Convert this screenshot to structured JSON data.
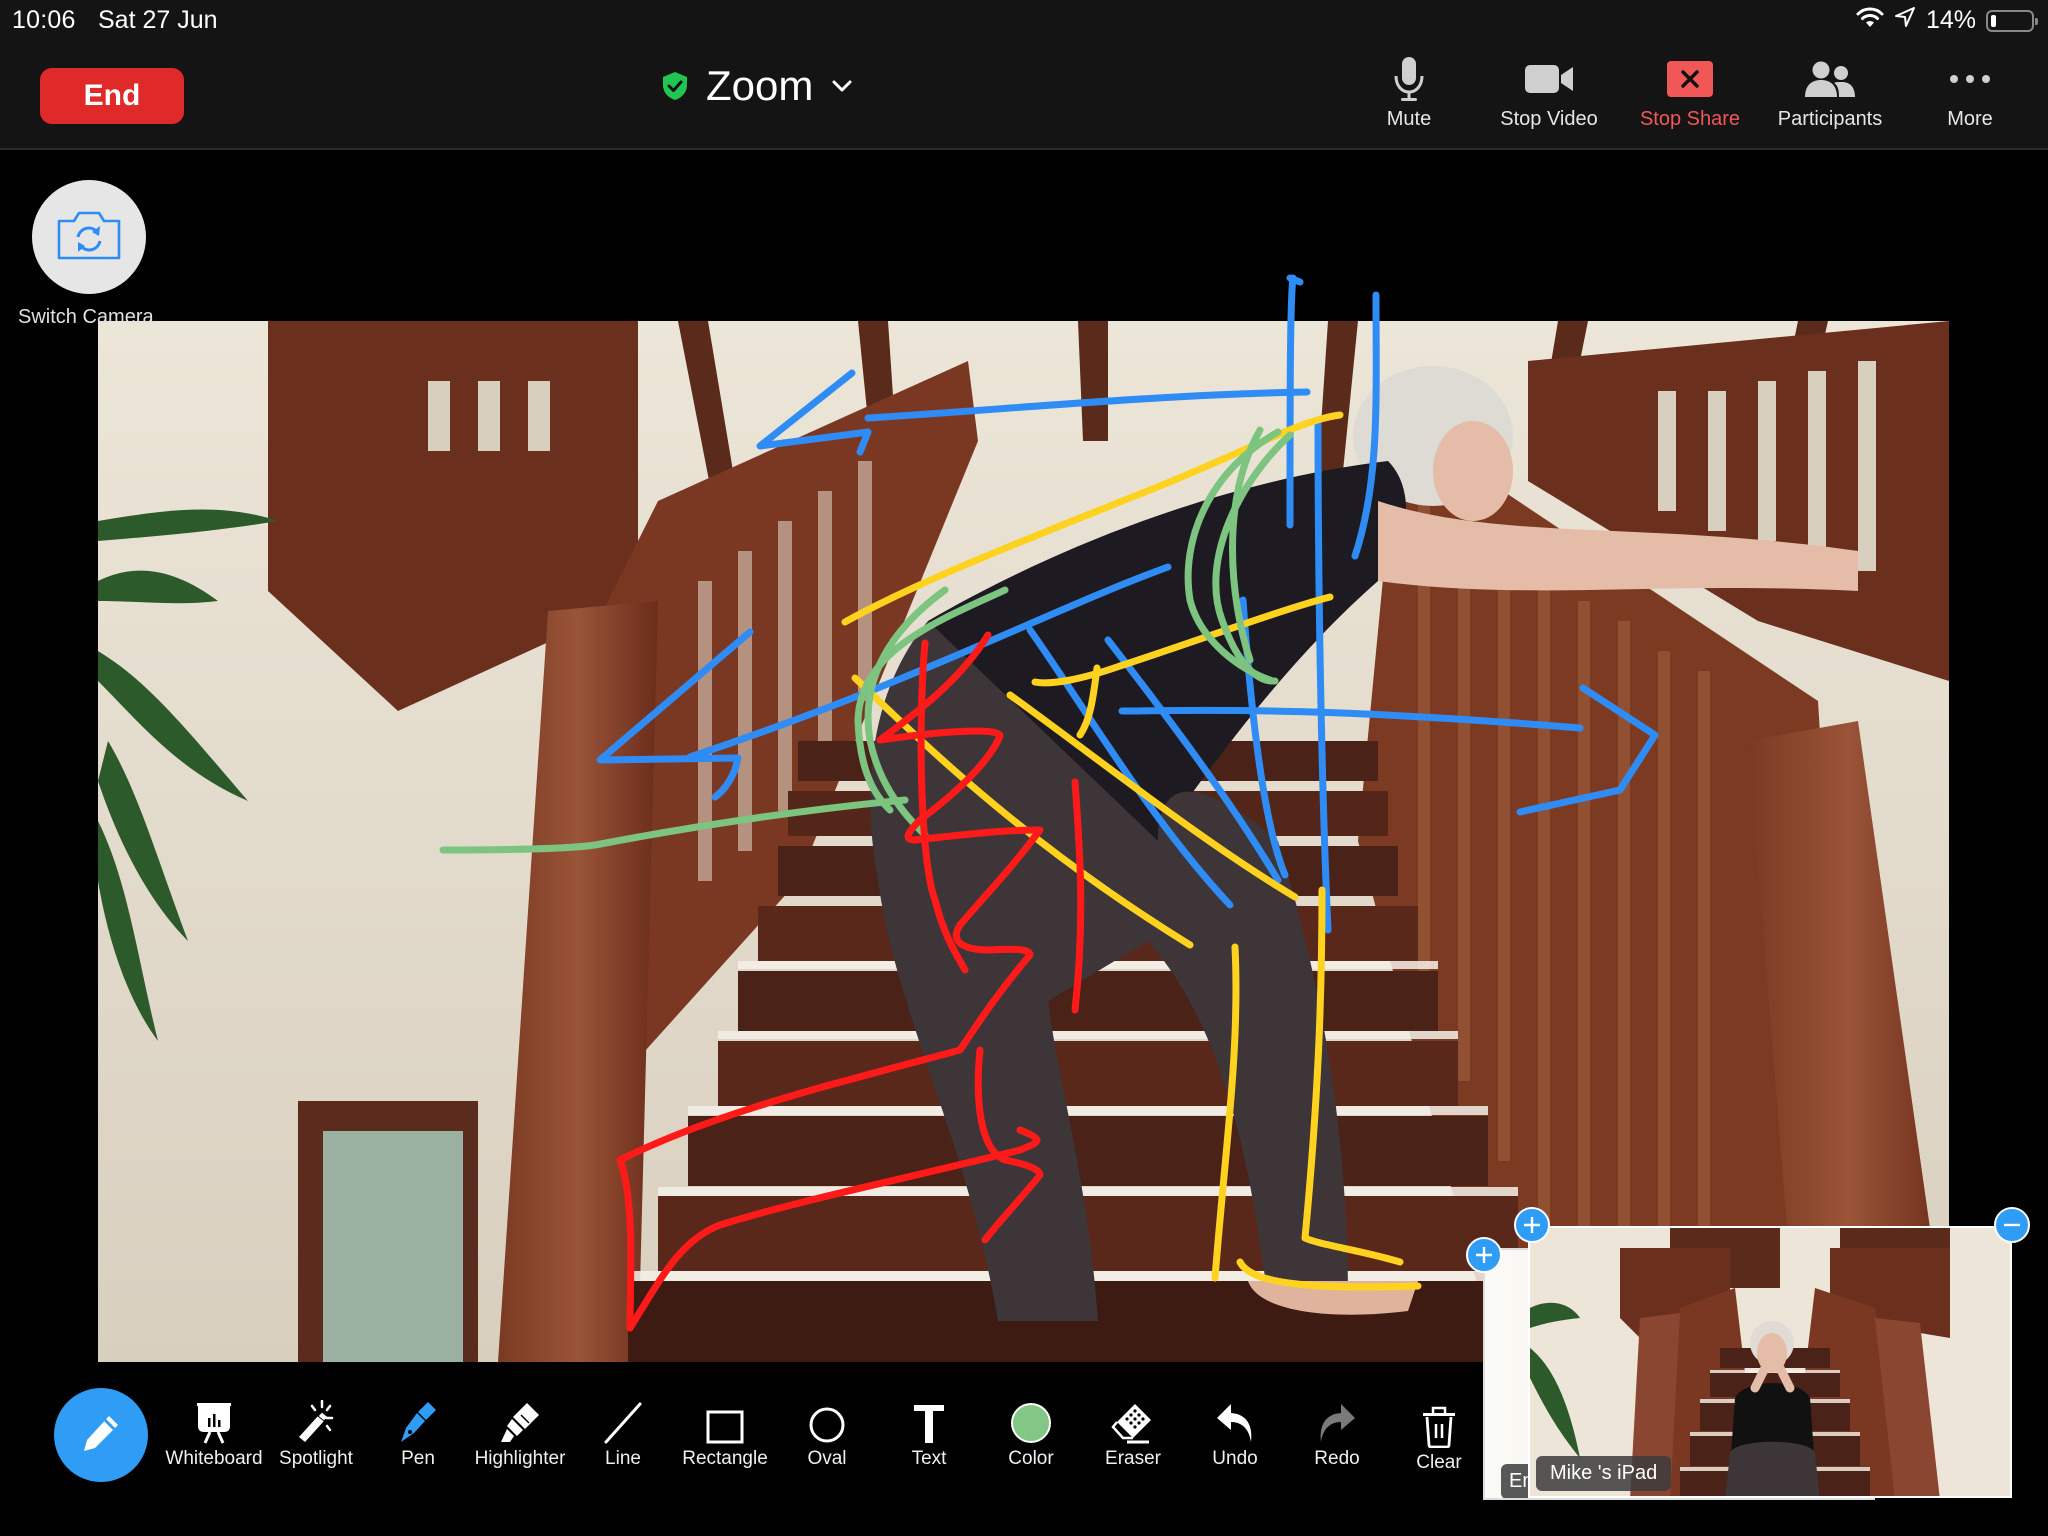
{
  "status_bar": {
    "time": "10:06",
    "date": "Sat 27 Jun",
    "battery_text": "14%",
    "battery_level": 0.14,
    "icons": [
      "wifi-icon",
      "location-arrow-icon",
      "battery-icon"
    ]
  },
  "top_bar": {
    "end_label": "End",
    "meeting_title": "Zoom",
    "security_icon": "shield-check-icon",
    "title_dropdown_icon": "chevron-down-icon",
    "controls": [
      {
        "label": "Mute",
        "icon": "microphone-icon"
      },
      {
        "label": "Stop Video",
        "icon": "video-camera-icon"
      },
      {
        "label": "Stop Share",
        "icon": "stop-share-icon"
      },
      {
        "label": "Participants",
        "icon": "participants-icon"
      },
      {
        "label": "More",
        "icon": "more-dots-icon"
      }
    ]
  },
  "switch_camera": {
    "label": "Switch Camera",
    "icon": "camera-rotate-icon"
  },
  "annotation_toolbar": {
    "active_tool_icon": "pencil-icon",
    "tools": [
      {
        "label": "Whiteboard",
        "icon": "whiteboard-icon"
      },
      {
        "label": "Spotlight",
        "icon": "spotlight-wand-icon"
      },
      {
        "label": "Pen",
        "icon": "pen-icon"
      },
      {
        "label": "Highlighter",
        "icon": "highlighter-icon"
      },
      {
        "label": "Line",
        "icon": "line-icon"
      },
      {
        "label": "Rectangle",
        "icon": "rectangle-icon"
      },
      {
        "label": "Oval",
        "icon": "oval-icon"
      },
      {
        "label": "Text",
        "icon": "text-icon"
      },
      {
        "label": "Color",
        "icon": "color-swatch-icon"
      },
      {
        "label": "Eraser",
        "icon": "eraser-icon"
      },
      {
        "label": "Undo",
        "icon": "undo-icon"
      },
      {
        "label": "Redo",
        "icon": "redo-icon"
      },
      {
        "label": "Clear",
        "icon": "trash-icon"
      }
    ],
    "selected_color": "#82c785"
  },
  "thumbnails": [
    {
      "name": "Em",
      "truncated": true
    },
    {
      "name": "Mike 's iPad"
    }
  ],
  "annotation_colors": {
    "blue": "#2f8cf5",
    "yellow": "#ffd21f",
    "green": "#7cc47f",
    "red": "#ff1a1a"
  },
  "colors": {
    "end_button": "#e02a2a",
    "stop_share": "#f25757",
    "accent_blue": "#2f9cf5",
    "shield_green": "#23c552"
  }
}
